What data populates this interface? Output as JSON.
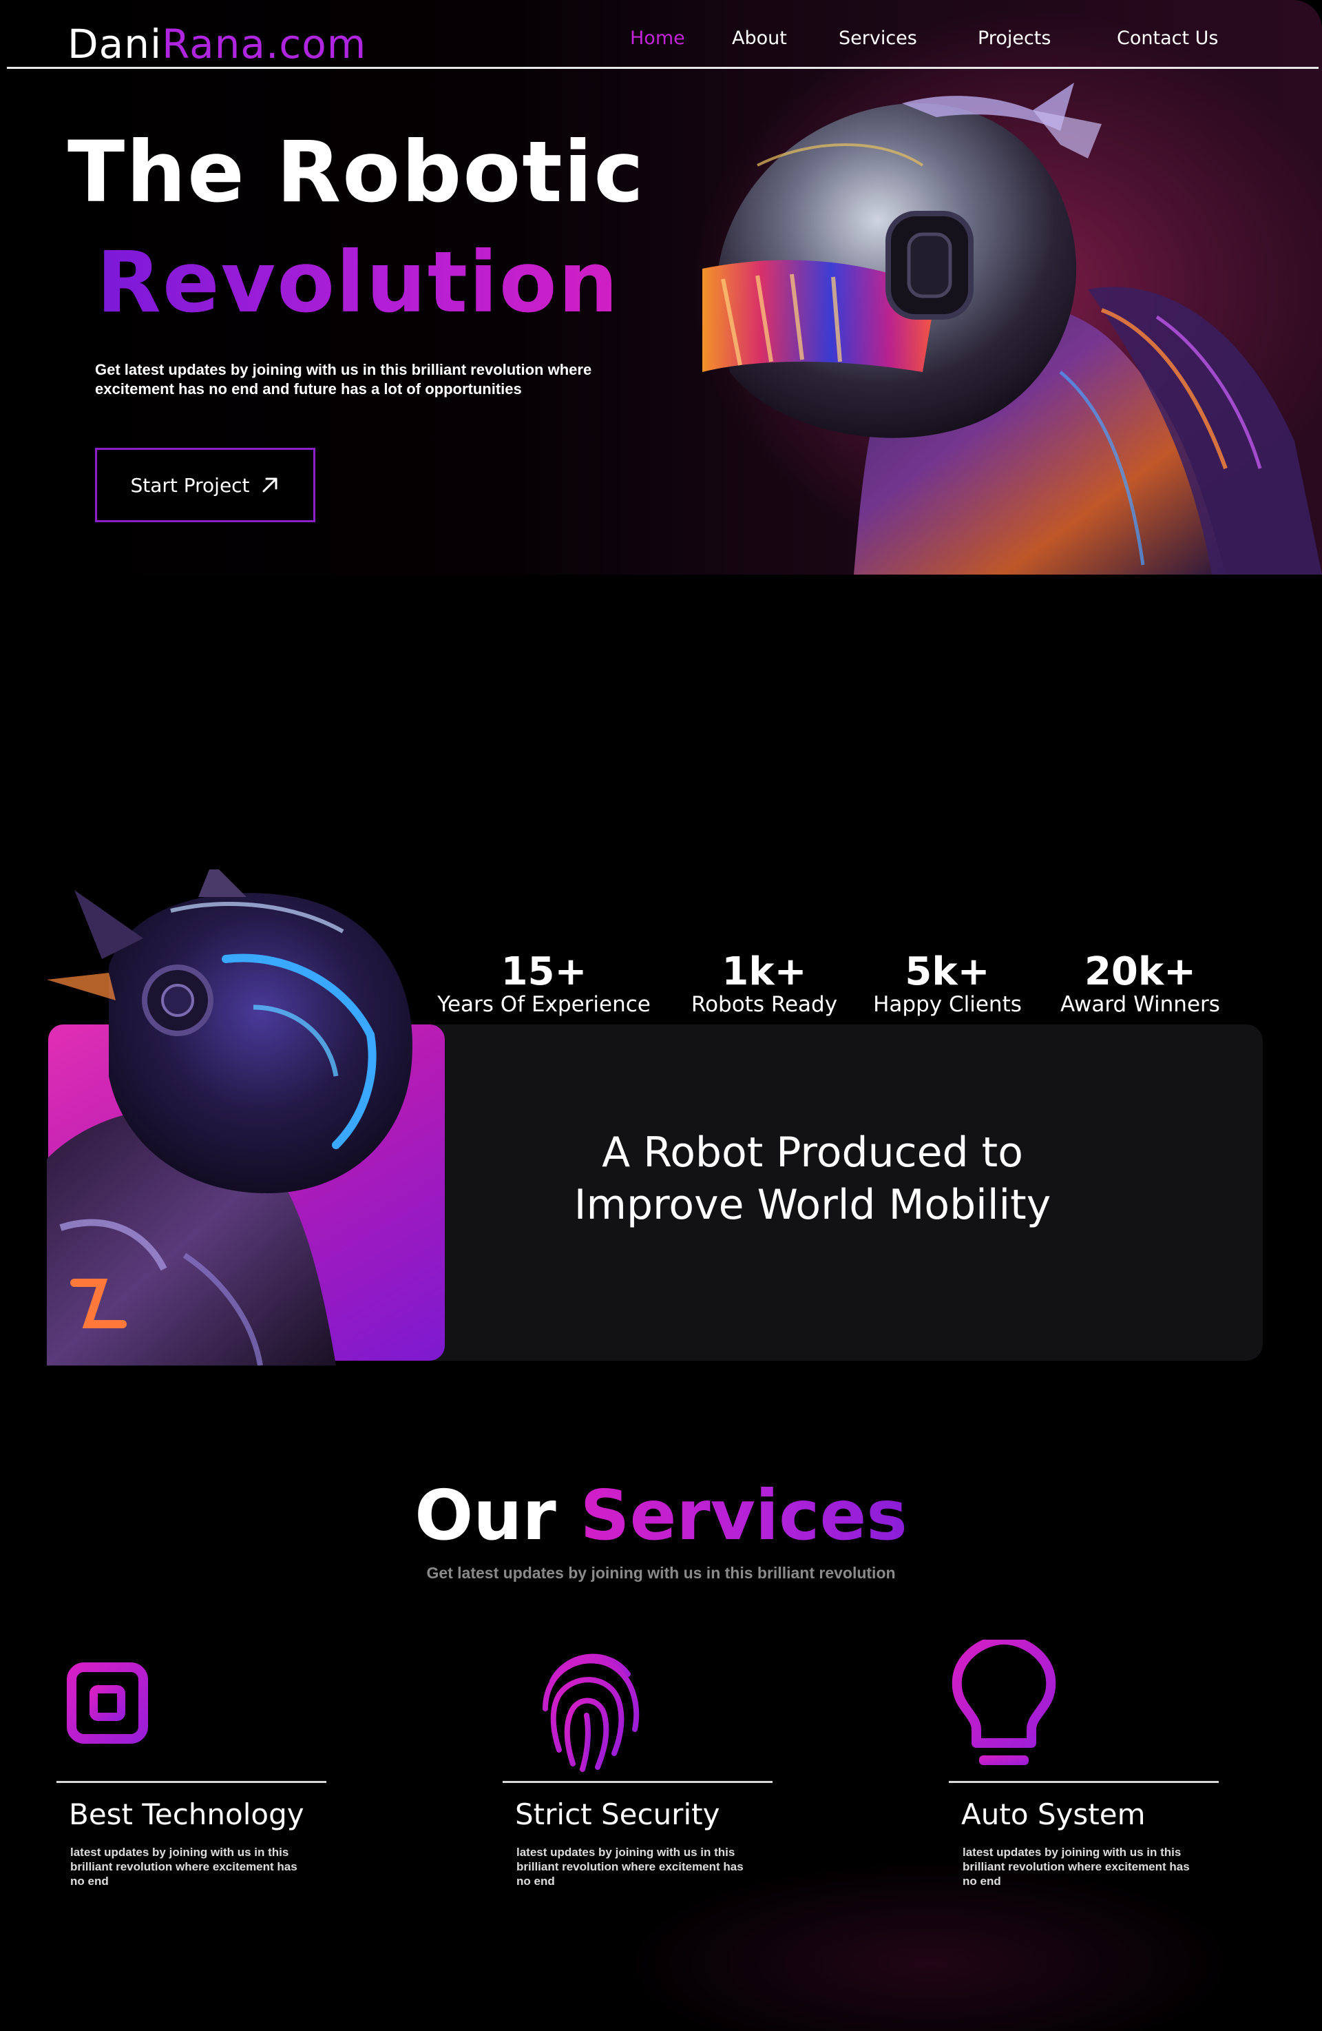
{
  "nav": {
    "logo_part1": "Dani",
    "logo_part2": "Rana.com",
    "items": [
      {
        "label": "Home",
        "active": true
      },
      {
        "label": "About",
        "active": false
      },
      {
        "label": "Services",
        "active": false
      },
      {
        "label": "Projects",
        "active": false
      },
      {
        "label": "Contact Us",
        "active": false
      }
    ]
  },
  "hero": {
    "title_line1": "The Robotic",
    "title_line2": "Revolution",
    "subtitle": "Get latest updates by joining with us in this brilliant revolution where excitement has no end and future has a lot of opportunities",
    "cta_label": "Start Project",
    "cta_icon": "arrow-up-right-icon"
  },
  "stats": [
    {
      "value": "15+",
      "label": "Years Of Experience"
    },
    {
      "value": "1k+",
      "label": "Robots Ready"
    },
    {
      "value": "5k+",
      "label": "Happy Clients"
    },
    {
      "value": "20k+",
      "label": "Award Winners"
    }
  ],
  "mission": {
    "line1": "A Robot Produced to",
    "line2": "Improve World Mobility"
  },
  "services": {
    "title_part1": "Our",
    "title_part2": "Services",
    "subtitle": "Get latest updates by joining with us in this brilliant revolution",
    "items": [
      {
        "title": "Best Technology",
        "icon": "chip-icon",
        "desc": "latest updates by joining with us in this brilliant revolution where excitement has no end"
      },
      {
        "title": "Strict Security",
        "icon": "fingerprint-icon",
        "desc": "latest updates by joining with us in this brilliant revolution where excitement has no end"
      },
      {
        "title": "Auto System",
        "icon": "lightbulb-icon",
        "desc": "latest updates by joining with us in this brilliant revolution where excitement has no end"
      }
    ]
  },
  "colors": {
    "accent": "#b026e0",
    "magenta": "#d01fc4",
    "background": "#000000",
    "card": "#121214"
  }
}
